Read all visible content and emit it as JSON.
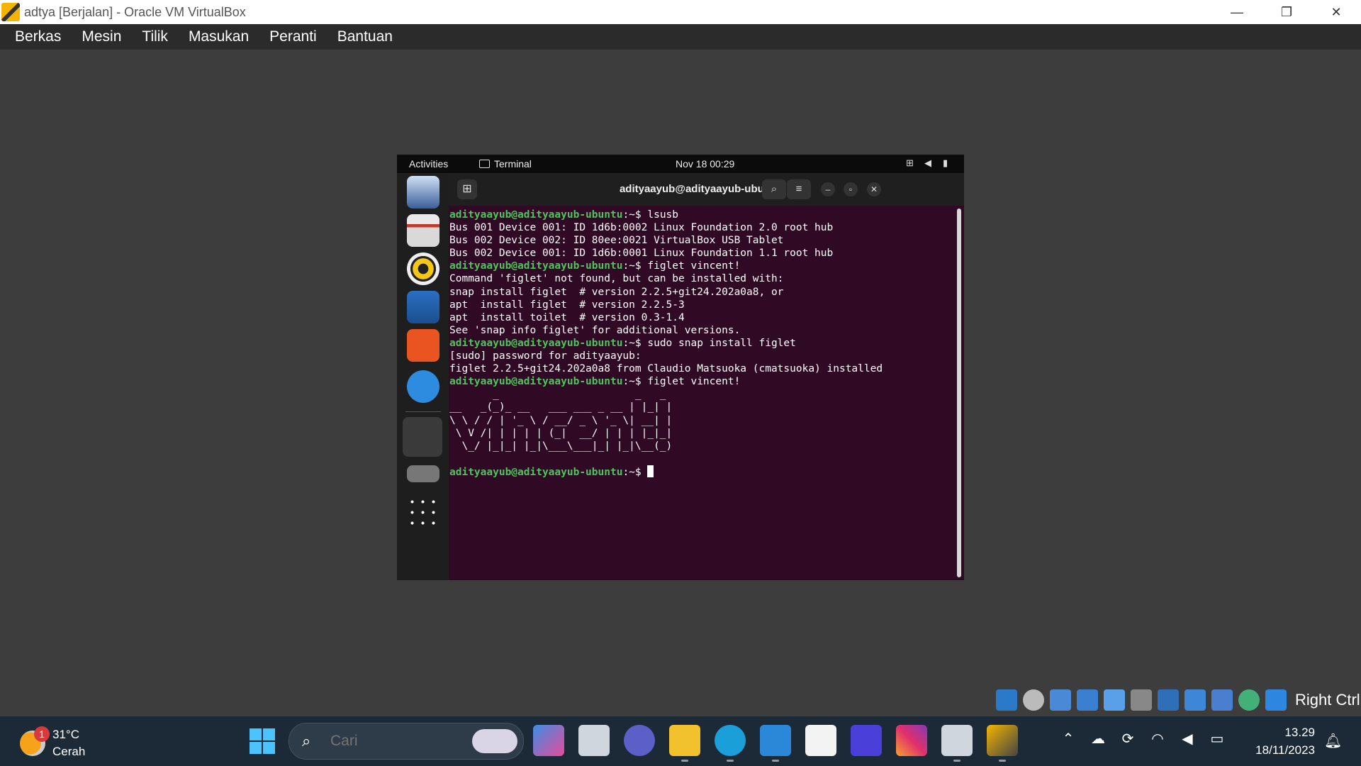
{
  "window": {
    "title": "adtya [Berjalan] - Oracle VM VirtualBox",
    "minimize": "—",
    "maximize": "❐",
    "close": "✕"
  },
  "menu": [
    "Berkas",
    "Mesin",
    "Tilik",
    "Masukan",
    "Peranti",
    "Bantuan"
  ],
  "ubuntu": {
    "activities": "Activities",
    "app": "Terminal",
    "clock": "Nov 18  00:29"
  },
  "terminal": {
    "title": "adityaayub@adityaayub-ubuntu: ~",
    "prompt": "adityaayub@adityaayub-ubuntu",
    "lines": [
      {
        "prompt": true,
        "cmd": "lsusb"
      },
      {
        "text": "Bus 001 Device 001: ID 1d6b:0002 Linux Foundation 2.0 root hub"
      },
      {
        "text": "Bus 002 Device 002: ID 80ee:0021 VirtualBox USB Tablet"
      },
      {
        "text": "Bus 002 Device 001: ID 1d6b:0001 Linux Foundation 1.1 root hub"
      },
      {
        "prompt": true,
        "cmd": "figlet vincent!"
      },
      {
        "text": "Command 'figlet' not found, but can be installed with:"
      },
      {
        "text": "snap install figlet  # version 2.2.5+git24.202a0a8, or"
      },
      {
        "text": "apt  install figlet  # version 2.2.5-3"
      },
      {
        "text": "apt  install toilet  # version 0.3-1.4"
      },
      {
        "text": "See 'snap info figlet' for additional versions."
      },
      {
        "prompt": true,
        "cmd": "sudo snap install figlet"
      },
      {
        "text": "[sudo] password for adityaayub:"
      },
      {
        "text": "figlet 2.2.5+git24.202a0a8 from Claudio Matsuoka (cmatsuoka) installed"
      },
      {
        "prompt": true,
        "cmd": "figlet vincent!"
      },
      {
        "text": "       _                      _   _ "
      },
      {
        "text": "__   _(_)_ __   ___ ___ _ __ | |_| |"
      },
      {
        "text": "\\ \\ / / | '_ \\ / __/ _ \\ '_ \\| __| |"
      },
      {
        "text": " \\ V /| | | | | (_|  __/ | | | |_|_|"
      },
      {
        "text": "  \\_/ |_|_| |_|\\___\\___|_| |_|\\__(_)"
      },
      {
        "text": ""
      },
      {
        "prompt": true,
        "cmd": "",
        "cursor": true
      }
    ]
  },
  "vbox_status": {
    "host_key": "Right Ctrl"
  },
  "taskbar": {
    "weather_temp": "31°C",
    "weather_desc": "Cerah",
    "weather_badge": "1",
    "search_placeholder": "Cari",
    "time": "13.29",
    "date": "18/11/2023"
  }
}
